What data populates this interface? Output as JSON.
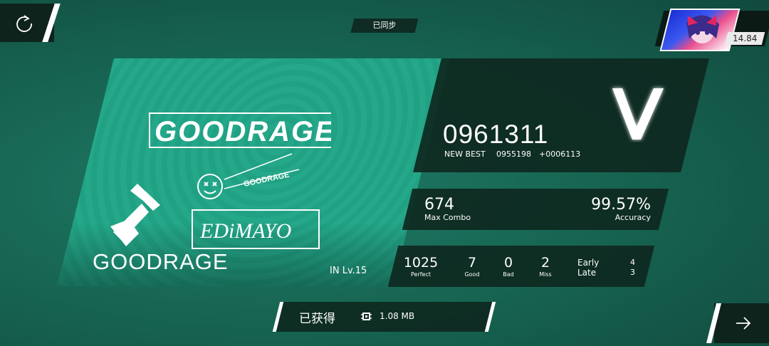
{
  "sync_status": "已同步",
  "player": {
    "rks": "14.84"
  },
  "song": {
    "title": "GOODRAGE",
    "difficulty": "IN",
    "level": "Lv.15"
  },
  "score": {
    "value": "0961311",
    "new_best_label": "NEW BEST",
    "previous_best": "0955198",
    "diff": "+0006113",
    "rank": "V"
  },
  "combo": {
    "value": "674",
    "label": "Max Combo"
  },
  "accuracy": {
    "value": "99.57%",
    "label": "Accuracy"
  },
  "judgements": [
    {
      "value": "1025",
      "label": "Perfect"
    },
    {
      "value": "7",
      "label": "Good"
    },
    {
      "value": "0",
      "label": "Bad"
    },
    {
      "value": "2",
      "label": "Miss"
    }
  ],
  "early_late": {
    "early_label": "Early",
    "late_label": "Late",
    "early": "4",
    "late": "3"
  },
  "reward": {
    "label": "已获得",
    "size": "1.08 MB"
  },
  "art_text": {
    "logo": "GOODRAGE",
    "small": "GOODRAGE",
    "artist": "EDiMAYO"
  },
  "colors": {
    "background": "#176653",
    "card": "#22a385",
    "panel": "#0e2820",
    "accent": "#ffffff"
  },
  "icons": {
    "retry": "retry-icon",
    "next": "arrow-right-icon",
    "size": "chip-icon"
  }
}
